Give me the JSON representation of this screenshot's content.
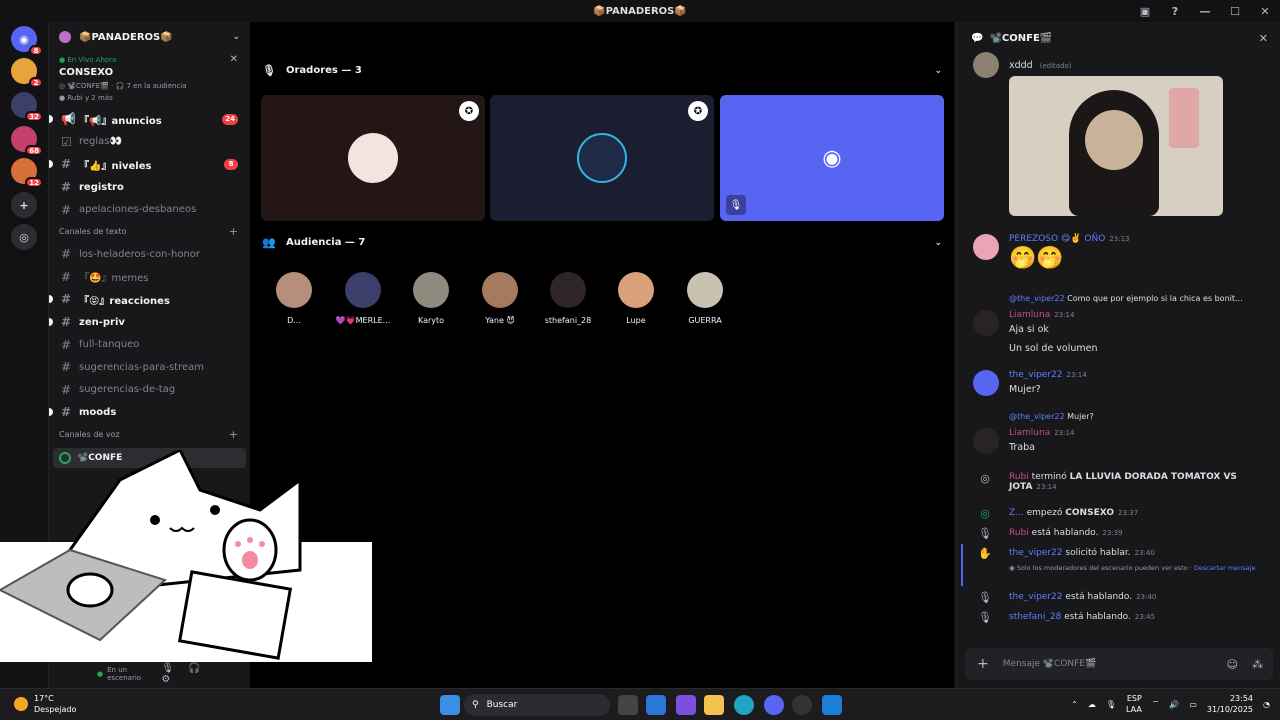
{
  "window": {
    "title": "📦PANADEROS📦"
  },
  "rail": {
    "servers": [
      {
        "name": "discord-home",
        "badge": "8",
        "color": "#5865f2"
      },
      {
        "name": "server-a",
        "badge": "2",
        "color": "#e8a33c"
      },
      {
        "name": "server-b",
        "badge": "32",
        "color": "#3b3f6a"
      },
      {
        "name": "server-c",
        "badge": "68",
        "color": "#c2406b"
      },
      {
        "name": "server-d",
        "badge": "12",
        "color": "#d66f3a"
      }
    ]
  },
  "sidebar": {
    "server_name": "📦PANADEROS📦",
    "live": {
      "label": "En Vivo Ahora",
      "title": "CONSEXO",
      "channel": "📽️CONFE🎬",
      "audience": "7 en la audiencia",
      "host_info": "Rubi y 2 más"
    },
    "channels": [
      {
        "name": "『📢』anuncios",
        "type": "announce",
        "unread": true,
        "badge": "24"
      },
      {
        "name": "reglas👀",
        "type": "rules",
        "unread": false,
        "badge": ""
      },
      {
        "name": "『👍』niveles",
        "type": "text",
        "unread": true,
        "badge": "8"
      },
      {
        "name": "registro",
        "type": "text",
        "unread": true,
        "badge": ""
      },
      {
        "name": "apelaciones-desbaneos",
        "type": "text",
        "unread": false,
        "badge": ""
      }
    ],
    "text_category": "Canales de texto",
    "text_channels": [
      {
        "name": "los-heladeros-con-honor",
        "unread": false
      },
      {
        "name": "『🤩』memes",
        "unread": false
      },
      {
        "name": "『😝』reacciones",
        "unread": true
      },
      {
        "name": "zen-priv",
        "unread": true
      },
      {
        "name": "full-tanqueo",
        "unread": false
      },
      {
        "name": "sugerencias-para-stream",
        "unread": false
      },
      {
        "name": "sugerencias-de-tag",
        "unread": false
      },
      {
        "name": "moods",
        "unread": true
      }
    ],
    "voice_category": "Canales de voz",
    "voice_channel": "📽️CONFE",
    "user_status": "En un escenario"
  },
  "stage": {
    "speakers_label": "Oradores — 3",
    "audience_label": "Audiencia — 7",
    "speakers": [
      {
        "name": "speaker-1",
        "bg": "#241616",
        "avatar": "#f3e4e0",
        "moderator": true
      },
      {
        "name": "speaker-2",
        "bg": "#1a1e30",
        "avatar": "#1f2b46",
        "moderator": true
      },
      {
        "name": "speaker-3",
        "bg": "#5865f2",
        "avatar": "",
        "moderator": false
      }
    ],
    "audience": [
      {
        "name": "D...",
        "color": "#b58f7c"
      },
      {
        "name": "💜💗MERLE...",
        "color": "#3b3f6a"
      },
      {
        "name": "Karyto",
        "color": "#8e8a7e"
      },
      {
        "name": "Yane 😈",
        "color": "#a57a5e"
      },
      {
        "name": "sthefani_28",
        "color": "#2e2526"
      },
      {
        "name": "Lupe",
        "color": "#d9a07a"
      },
      {
        "name": "GUERRA",
        "color": "#c9c2b1"
      }
    ]
  },
  "chat": {
    "title": "📽️CONFE🎬",
    "input_placeholder": "Mensaje 📽️CONFE🎬",
    "messages": [
      {
        "kind": "text",
        "text": "xddd",
        "edited": "(editado)"
      },
      {
        "kind": "user",
        "author": "PEREZOSO 😋✌️ OÑO",
        "time": "23:13",
        "text": "🤭🤭"
      },
      {
        "kind": "reply",
        "reply_to": "@the_viper22",
        "reply_text": "Como que por ejemplo si la chica es bonit...",
        "author": "Liamluna",
        "time": "23:14",
        "lines": [
          "Aja si ok",
          "Un sol de volumen"
        ]
      },
      {
        "kind": "user",
        "author": "the_viper22",
        "time": "23:14",
        "text": "Mujer?"
      },
      {
        "kind": "reply",
        "reply_to": "@the_viper22",
        "reply_text": "Mujer?",
        "author": "Liamluna",
        "time": "23:14",
        "lines": [
          "Traba"
        ]
      },
      {
        "kind": "system",
        "actor": "Rubi",
        "text": "terminó",
        "bold": "LA LLUVIA DORADA TOMATOX VS JOTA",
        "time": "23:14"
      },
      {
        "kind": "system",
        "actor": "Z...",
        "text": "empezó",
        "bold": "CONSEXO",
        "time": "23:37"
      },
      {
        "kind": "system",
        "actor": "Rubi",
        "text": "está hablando.",
        "bold": "",
        "time": "23:39"
      },
      {
        "kind": "system",
        "actor": "the_viper22",
        "text": "solicitó hablar.",
        "bold": "",
        "time": "23:40",
        "note": "Solo los moderadores del escenario pueden ver esto ·",
        "note_link": "Descartar mensaje"
      },
      {
        "kind": "system",
        "actor": "the_viper22",
        "text": "está hablando.",
        "bold": "",
        "time": "23:40"
      },
      {
        "kind": "system",
        "actor": "sthefani_28",
        "text": "está hablando.",
        "bold": "",
        "time": "23:45"
      }
    ]
  },
  "taskbar": {
    "temperature": "17°C",
    "weather": "Despejado",
    "search": "Buscar",
    "lang": "ESP",
    "lang2": "LAA",
    "time": "23:54",
    "date": "31/10/2025"
  }
}
